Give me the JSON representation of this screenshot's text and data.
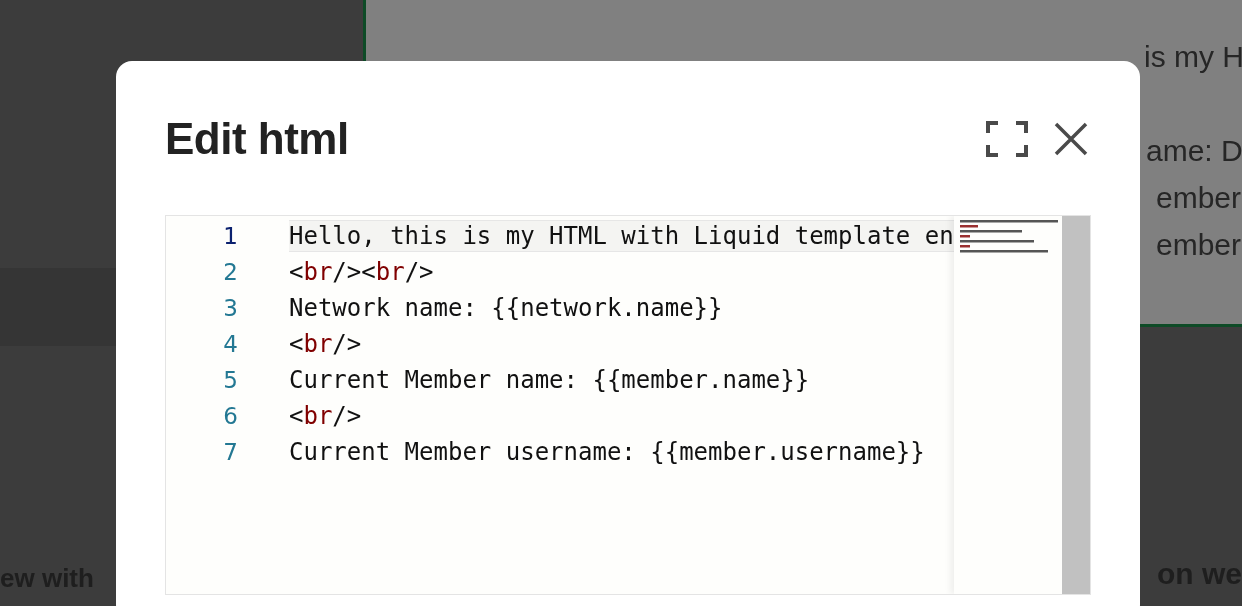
{
  "background": {
    "preview_lines": [
      "is my H",
      "ame: D",
      "ember",
      "ember"
    ],
    "left_caption": "ew with",
    "right_caption": "on we"
  },
  "dialog": {
    "title": "Edit html",
    "editor": {
      "lines": [
        {
          "number": "1",
          "current": true,
          "segments": [
            {
              "kind": "text",
              "text": "Hello, this is my HTML with Liquid template en"
            }
          ]
        },
        {
          "number": "2",
          "current": false,
          "segments": [
            {
              "kind": "punct",
              "text": "<"
            },
            {
              "kind": "tag",
              "text": "br"
            },
            {
              "kind": "punct",
              "text": "/><"
            },
            {
              "kind": "tag",
              "text": "br"
            },
            {
              "kind": "punct",
              "text": "/>"
            }
          ]
        },
        {
          "number": "3",
          "current": false,
          "segments": [
            {
              "kind": "text",
              "text": "Network name: {{network.name}}"
            }
          ]
        },
        {
          "number": "4",
          "current": false,
          "segments": [
            {
              "kind": "punct",
              "text": "<"
            },
            {
              "kind": "tag",
              "text": "br"
            },
            {
              "kind": "punct",
              "text": "/>"
            }
          ]
        },
        {
          "number": "5",
          "current": false,
          "segments": [
            {
              "kind": "text",
              "text": "Current Member name: {{member.name}}"
            }
          ]
        },
        {
          "number": "6",
          "current": false,
          "segments": [
            {
              "kind": "punct",
              "text": "<"
            },
            {
              "kind": "tag",
              "text": "br"
            },
            {
              "kind": "punct",
              "text": "/>"
            }
          ]
        },
        {
          "number": "7",
          "current": false,
          "segments": [
            {
              "kind": "text",
              "text": "Current Member username: {{member.username}}"
            }
          ]
        }
      ]
    }
  }
}
